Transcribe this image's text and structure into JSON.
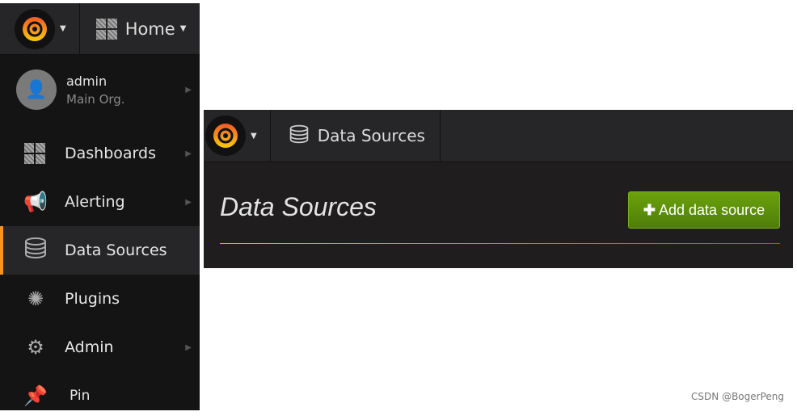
{
  "left_panel": {
    "nav": {
      "home_label": "Home"
    },
    "user": {
      "name": "admin",
      "org": "Main Org."
    },
    "menu": [
      {
        "label": "Dashboards",
        "icon": "dashboards-grid-icon",
        "has_submenu": true
      },
      {
        "label": "Alerting",
        "icon": "megaphone-icon",
        "has_submenu": true
      },
      {
        "label": "Data Sources",
        "icon": "database-icon",
        "has_submenu": false,
        "active": true
      },
      {
        "label": "Plugins",
        "icon": "plugins-icon",
        "has_submenu": false
      },
      {
        "label": "Admin",
        "icon": "gears-icon",
        "has_submenu": true
      },
      {
        "label": "Pin",
        "icon": "pin-icon",
        "has_submenu": false
      }
    ]
  },
  "right_panel": {
    "breadcrumb": "Data Sources",
    "page_title": "Data Sources",
    "add_button": "Add data source"
  },
  "colors": {
    "accent": "#f7941e",
    "button_green": "#5f9a0b",
    "background": "#1f1d1e"
  },
  "watermark": "CSDN @BogerPeng"
}
